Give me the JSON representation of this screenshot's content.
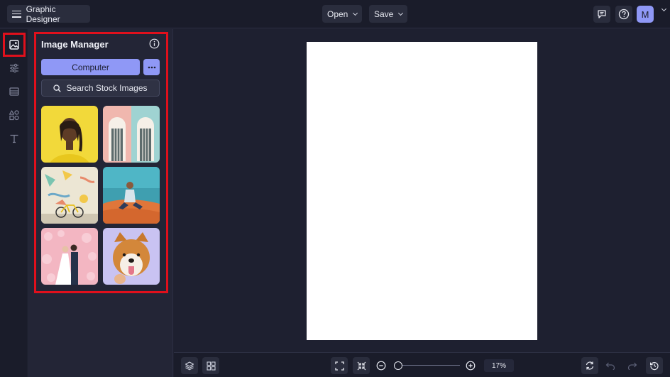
{
  "header": {
    "app_title": "Graphic Designer",
    "menu_icon": "hamburger-menu-icon",
    "open_label": "Open",
    "save_label": "Save",
    "feedback_icon": "comment-icon",
    "help_icon": "help-icon",
    "avatar_initial": "M"
  },
  "sidebar": {
    "items": [
      {
        "name": "image-icon",
        "active": true
      },
      {
        "name": "adjustments-icon",
        "active": false
      },
      {
        "name": "background-icon",
        "active": false
      },
      {
        "name": "shapes-icon",
        "active": false
      },
      {
        "name": "text-icon",
        "active": false
      }
    ]
  },
  "image_manager": {
    "title": "Image Manager",
    "info_icon": "info-icon",
    "computer_label": "Computer",
    "more_icon": "more-options-icon",
    "search_label": "Search Stock Images",
    "images": [
      {
        "subject": "woman portrait on yellow background"
      },
      {
        "subject": "pastel doorways"
      },
      {
        "subject": "bicycle and mural wall"
      },
      {
        "subject": "man sitting on desert sand"
      },
      {
        "subject": "wedding couple with pink flowers"
      },
      {
        "subject": "shiba inu dog on lavender background"
      }
    ]
  },
  "footer": {
    "layers_icon": "layers-icon",
    "grid_icon": "grid-icon",
    "fit_icon": "fit-to-screen-icon",
    "shrink_icon": "shrink-icon",
    "zoom_out_icon": "zoom-out-icon",
    "zoom_in_icon": "zoom-in-icon",
    "zoom_level": "17%",
    "zoom_fraction": 0.17,
    "sync_icon": "sync-icon",
    "undo_icon": "undo-icon",
    "redo_icon": "redo-icon",
    "history_icon": "history-icon"
  },
  "colors": {
    "accent": "#8f98f6",
    "highlight": "#e0101c",
    "canvas": "#ffffff",
    "background": "#1e2030"
  }
}
